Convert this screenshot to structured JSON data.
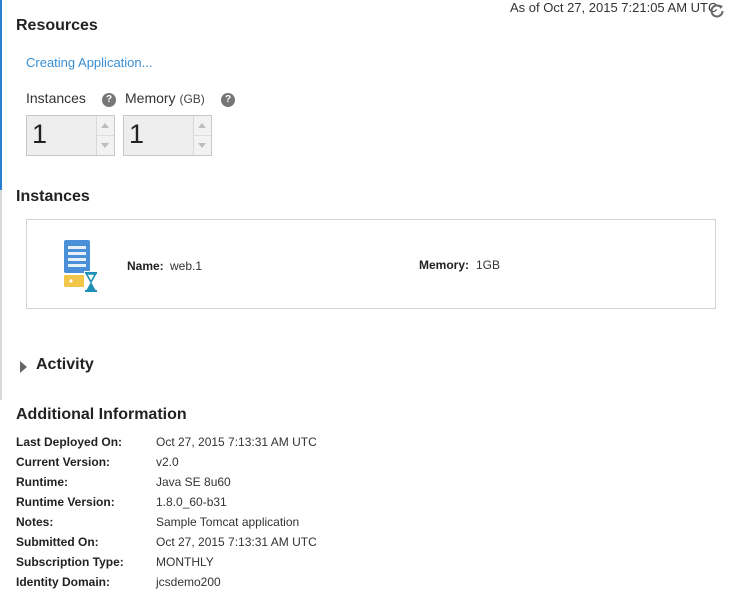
{
  "header": {
    "timestamp": "As of Oct 27, 2015 7:21:05 AM UTC",
    "refresh_icon": "refresh-icon"
  },
  "resources": {
    "title": "Resources",
    "status": "Creating Application...",
    "instances_label": "Instances",
    "memory_label": "Memory",
    "memory_unit": "(GB)",
    "instances_value": "1",
    "memory_value": "1",
    "help_icon": "question-icon"
  },
  "instances": {
    "title": "Instances",
    "items": [
      {
        "icon": "server-pending-icon",
        "name_label": "Name:",
        "name_value": "web.1",
        "memory_label": "Memory:",
        "memory_value": "1GB"
      }
    ]
  },
  "activity": {
    "title": "Activity",
    "expanded": false
  },
  "additional_info": {
    "title": "Additional Information",
    "rows": [
      {
        "key": "Last Deployed On:",
        "value": "Oct 27, 2015 7:13:31 AM UTC"
      },
      {
        "key": "Current Version:",
        "value": "v2.0"
      },
      {
        "key": "Runtime:",
        "value": "Java SE 8u60"
      },
      {
        "key": "Runtime Version:",
        "value": "1.8.0_60-b31"
      },
      {
        "key": "Notes:",
        "value": "Sample Tomcat application"
      },
      {
        "key": "Submitted On:",
        "value": "Oct 27, 2015 7:13:31 AM UTC"
      },
      {
        "key": "Subscription Type:",
        "value": "MONTHLY"
      },
      {
        "key": "Identity Domain:",
        "value": "jcsdemo200"
      }
    ]
  },
  "colors": {
    "accent": "#2b7fd0",
    "link": "#3a8fd4",
    "icon_blue": "#4a90d9",
    "icon_yellow": "#f2c649",
    "hourglass": "#1f8fb5"
  }
}
